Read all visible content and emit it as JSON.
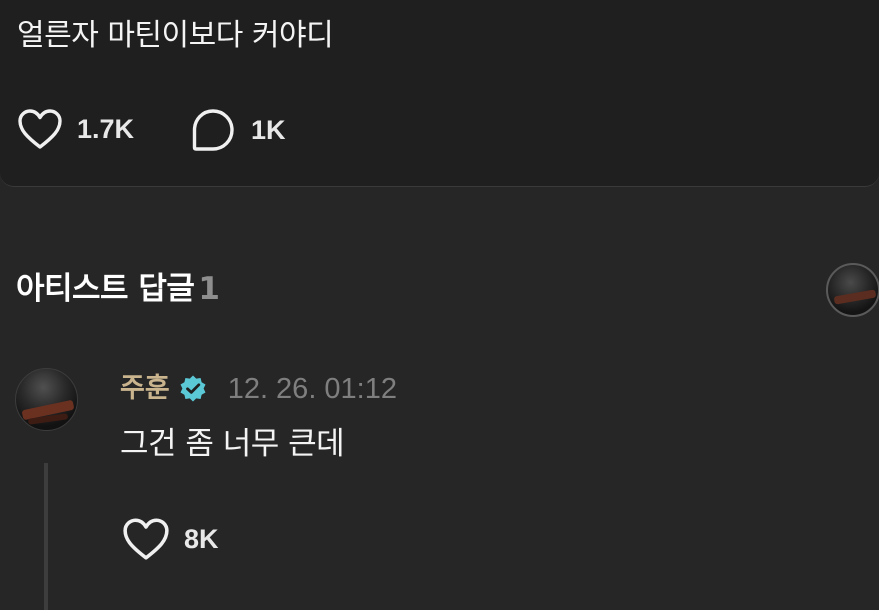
{
  "post": {
    "text": "얼른자 마틴이보다 커야디",
    "likes": "1.7K",
    "comments": "1K"
  },
  "artist_replies": {
    "title": "아티스트 답글",
    "count": "1"
  },
  "reply": {
    "author": "주훈",
    "verified": true,
    "timestamp": "12. 26. 01:12",
    "text": "그건 좀 너무 큰데",
    "likes": "8K"
  },
  "colors": {
    "background": "#262626",
    "card": "#1f1f1f",
    "author": "#c9b48e",
    "verified_badge": "#5bc8d6",
    "muted": "#7f7f7f"
  }
}
